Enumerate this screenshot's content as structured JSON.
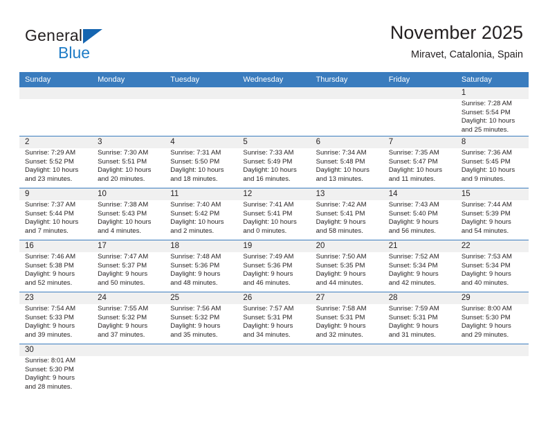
{
  "brand": {
    "name_top": "General",
    "name_bottom": "Blue",
    "accent_dark": "#1565b0",
    "accent_light": "#1f7cc6"
  },
  "header": {
    "title": "November 2025",
    "subtitle": "Miravet, Catalonia, Spain"
  },
  "theme": {
    "header_blue": "#3a7cbe",
    "daynum_band": "#f0f0f0",
    "text": "#231f20"
  },
  "weekdays": [
    "Sunday",
    "Monday",
    "Tuesday",
    "Wednesday",
    "Thursday",
    "Friday",
    "Saturday"
  ],
  "weeks": [
    [
      {
        "day": "",
        "sunrise": "",
        "sunset": "",
        "daylight_line1": "",
        "daylight_line2": ""
      },
      {
        "day": "",
        "sunrise": "",
        "sunset": "",
        "daylight_line1": "",
        "daylight_line2": ""
      },
      {
        "day": "",
        "sunrise": "",
        "sunset": "",
        "daylight_line1": "",
        "daylight_line2": ""
      },
      {
        "day": "",
        "sunrise": "",
        "sunset": "",
        "daylight_line1": "",
        "daylight_line2": ""
      },
      {
        "day": "",
        "sunrise": "",
        "sunset": "",
        "daylight_line1": "",
        "daylight_line2": ""
      },
      {
        "day": "",
        "sunrise": "",
        "sunset": "",
        "daylight_line1": "",
        "daylight_line2": ""
      },
      {
        "day": "1",
        "sunrise": "Sunrise: 7:28 AM",
        "sunset": "Sunset: 5:54 PM",
        "daylight_line1": "Daylight: 10 hours",
        "daylight_line2": "and 25 minutes."
      }
    ],
    [
      {
        "day": "2",
        "sunrise": "Sunrise: 7:29 AM",
        "sunset": "Sunset: 5:52 PM",
        "daylight_line1": "Daylight: 10 hours",
        "daylight_line2": "and 23 minutes."
      },
      {
        "day": "3",
        "sunrise": "Sunrise: 7:30 AM",
        "sunset": "Sunset: 5:51 PM",
        "daylight_line1": "Daylight: 10 hours",
        "daylight_line2": "and 20 minutes."
      },
      {
        "day": "4",
        "sunrise": "Sunrise: 7:31 AM",
        "sunset": "Sunset: 5:50 PM",
        "daylight_line1": "Daylight: 10 hours",
        "daylight_line2": "and 18 minutes."
      },
      {
        "day": "5",
        "sunrise": "Sunrise: 7:33 AM",
        "sunset": "Sunset: 5:49 PM",
        "daylight_line1": "Daylight: 10 hours",
        "daylight_line2": "and 16 minutes."
      },
      {
        "day": "6",
        "sunrise": "Sunrise: 7:34 AM",
        "sunset": "Sunset: 5:48 PM",
        "daylight_line1": "Daylight: 10 hours",
        "daylight_line2": "and 13 minutes."
      },
      {
        "day": "7",
        "sunrise": "Sunrise: 7:35 AM",
        "sunset": "Sunset: 5:47 PM",
        "daylight_line1": "Daylight: 10 hours",
        "daylight_line2": "and 11 minutes."
      },
      {
        "day": "8",
        "sunrise": "Sunrise: 7:36 AM",
        "sunset": "Sunset: 5:45 PM",
        "daylight_line1": "Daylight: 10 hours",
        "daylight_line2": "and 9 minutes."
      }
    ],
    [
      {
        "day": "9",
        "sunrise": "Sunrise: 7:37 AM",
        "sunset": "Sunset: 5:44 PM",
        "daylight_line1": "Daylight: 10 hours",
        "daylight_line2": "and 7 minutes."
      },
      {
        "day": "10",
        "sunrise": "Sunrise: 7:38 AM",
        "sunset": "Sunset: 5:43 PM",
        "daylight_line1": "Daylight: 10 hours",
        "daylight_line2": "and 4 minutes."
      },
      {
        "day": "11",
        "sunrise": "Sunrise: 7:40 AM",
        "sunset": "Sunset: 5:42 PM",
        "daylight_line1": "Daylight: 10 hours",
        "daylight_line2": "and 2 minutes."
      },
      {
        "day": "12",
        "sunrise": "Sunrise: 7:41 AM",
        "sunset": "Sunset: 5:41 PM",
        "daylight_line1": "Daylight: 10 hours",
        "daylight_line2": "and 0 minutes."
      },
      {
        "day": "13",
        "sunrise": "Sunrise: 7:42 AM",
        "sunset": "Sunset: 5:41 PM",
        "daylight_line1": "Daylight: 9 hours",
        "daylight_line2": "and 58 minutes."
      },
      {
        "day": "14",
        "sunrise": "Sunrise: 7:43 AM",
        "sunset": "Sunset: 5:40 PM",
        "daylight_line1": "Daylight: 9 hours",
        "daylight_line2": "and 56 minutes."
      },
      {
        "day": "15",
        "sunrise": "Sunrise: 7:44 AM",
        "sunset": "Sunset: 5:39 PM",
        "daylight_line1": "Daylight: 9 hours",
        "daylight_line2": "and 54 minutes."
      }
    ],
    [
      {
        "day": "16",
        "sunrise": "Sunrise: 7:46 AM",
        "sunset": "Sunset: 5:38 PM",
        "daylight_line1": "Daylight: 9 hours",
        "daylight_line2": "and 52 minutes."
      },
      {
        "day": "17",
        "sunrise": "Sunrise: 7:47 AM",
        "sunset": "Sunset: 5:37 PM",
        "daylight_line1": "Daylight: 9 hours",
        "daylight_line2": "and 50 minutes."
      },
      {
        "day": "18",
        "sunrise": "Sunrise: 7:48 AM",
        "sunset": "Sunset: 5:36 PM",
        "daylight_line1": "Daylight: 9 hours",
        "daylight_line2": "and 48 minutes."
      },
      {
        "day": "19",
        "sunrise": "Sunrise: 7:49 AM",
        "sunset": "Sunset: 5:36 PM",
        "daylight_line1": "Daylight: 9 hours",
        "daylight_line2": "and 46 minutes."
      },
      {
        "day": "20",
        "sunrise": "Sunrise: 7:50 AM",
        "sunset": "Sunset: 5:35 PM",
        "daylight_line1": "Daylight: 9 hours",
        "daylight_line2": "and 44 minutes."
      },
      {
        "day": "21",
        "sunrise": "Sunrise: 7:52 AM",
        "sunset": "Sunset: 5:34 PM",
        "daylight_line1": "Daylight: 9 hours",
        "daylight_line2": "and 42 minutes."
      },
      {
        "day": "22",
        "sunrise": "Sunrise: 7:53 AM",
        "sunset": "Sunset: 5:34 PM",
        "daylight_line1": "Daylight: 9 hours",
        "daylight_line2": "and 40 minutes."
      }
    ],
    [
      {
        "day": "23",
        "sunrise": "Sunrise: 7:54 AM",
        "sunset": "Sunset: 5:33 PM",
        "daylight_line1": "Daylight: 9 hours",
        "daylight_line2": "and 39 minutes."
      },
      {
        "day": "24",
        "sunrise": "Sunrise: 7:55 AM",
        "sunset": "Sunset: 5:32 PM",
        "daylight_line1": "Daylight: 9 hours",
        "daylight_line2": "and 37 minutes."
      },
      {
        "day": "25",
        "sunrise": "Sunrise: 7:56 AM",
        "sunset": "Sunset: 5:32 PM",
        "daylight_line1": "Daylight: 9 hours",
        "daylight_line2": "and 35 minutes."
      },
      {
        "day": "26",
        "sunrise": "Sunrise: 7:57 AM",
        "sunset": "Sunset: 5:31 PM",
        "daylight_line1": "Daylight: 9 hours",
        "daylight_line2": "and 34 minutes."
      },
      {
        "day": "27",
        "sunrise": "Sunrise: 7:58 AM",
        "sunset": "Sunset: 5:31 PM",
        "daylight_line1": "Daylight: 9 hours",
        "daylight_line2": "and 32 minutes."
      },
      {
        "day": "28",
        "sunrise": "Sunrise: 7:59 AM",
        "sunset": "Sunset: 5:31 PM",
        "daylight_line1": "Daylight: 9 hours",
        "daylight_line2": "and 31 minutes."
      },
      {
        "day": "29",
        "sunrise": "Sunrise: 8:00 AM",
        "sunset": "Sunset: 5:30 PM",
        "daylight_line1": "Daylight: 9 hours",
        "daylight_line2": "and 29 minutes."
      }
    ],
    [
      {
        "day": "30",
        "sunrise": "Sunrise: 8:01 AM",
        "sunset": "Sunset: 5:30 PM",
        "daylight_line1": "Daylight: 9 hours",
        "daylight_line2": "and 28 minutes."
      },
      {
        "day": "",
        "sunrise": "",
        "sunset": "",
        "daylight_line1": "",
        "daylight_line2": ""
      },
      {
        "day": "",
        "sunrise": "",
        "sunset": "",
        "daylight_line1": "",
        "daylight_line2": ""
      },
      {
        "day": "",
        "sunrise": "",
        "sunset": "",
        "daylight_line1": "",
        "daylight_line2": ""
      },
      {
        "day": "",
        "sunrise": "",
        "sunset": "",
        "daylight_line1": "",
        "daylight_line2": ""
      },
      {
        "day": "",
        "sunrise": "",
        "sunset": "",
        "daylight_line1": "",
        "daylight_line2": ""
      },
      {
        "day": "",
        "sunrise": "",
        "sunset": "",
        "daylight_line1": "",
        "daylight_line2": ""
      }
    ]
  ]
}
